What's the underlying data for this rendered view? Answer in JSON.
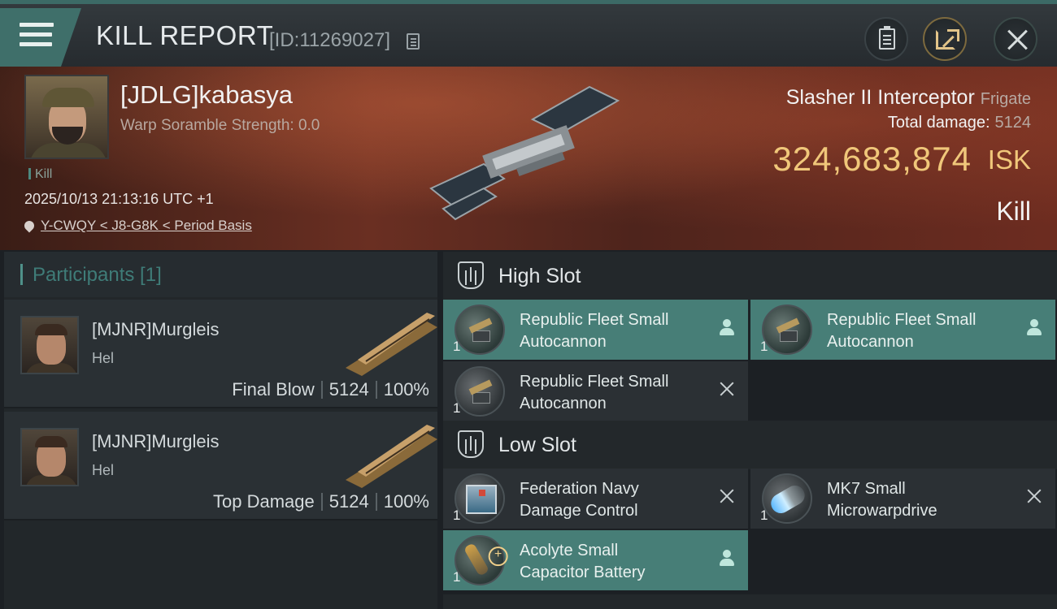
{
  "header": {
    "title": "KILL REPORT",
    "report_id": "[ID:11269027]",
    "menu_icon": "hamburger-icon",
    "buttons": [
      "clipboard-icon",
      "share-icon",
      "close-icon"
    ]
  },
  "victim": {
    "name": "[JDLG]kabasya",
    "warp_scramble": "Warp Soramble Strength: 0.0",
    "kill_tag": "Kill",
    "time": "2025/10/13 21:13:16 UTC +1",
    "location": "Y-CWQY < J8-G8K < Period Basis",
    "ship_name": "Slasher II Interceptor",
    "ship_class": "Frigate",
    "total_damage_label": "Total damage:",
    "total_damage_value": "5124",
    "isk_value": "324,683,874",
    "isk_unit": "ISK",
    "result": "Kill"
  },
  "participants": {
    "title": "Participants [1]",
    "items": [
      {
        "name": "[MJNR]Murgleis",
        "ship": "Hel",
        "role": "Final Blow",
        "damage": "5124",
        "percent": "100%"
      },
      {
        "name": "[MJNR]Murgleis",
        "ship": "Hel",
        "role": "Top Damage",
        "damage": "5124",
        "percent": "100%"
      }
    ]
  },
  "fitting": {
    "high_slot": {
      "title": "High Slot",
      "modules": [
        {
          "qty": "1",
          "line1": "Republic Fleet Small",
          "line2": "Autocannon",
          "status": "pilot-icon"
        },
        {
          "qty": "1",
          "line1": "Republic Fleet Small",
          "line2": "Autocannon",
          "status": "pilot-icon"
        },
        {
          "qty": "1",
          "line1": "Republic Fleet Small",
          "line2": "Autocannon",
          "status": "destroyed-x-icon"
        }
      ]
    },
    "low_slot": {
      "title": "Low Slot",
      "modules": [
        {
          "qty": "1",
          "line1": "Federation Navy",
          "line2": "Damage Control",
          "status": "destroyed-x-icon"
        },
        {
          "qty": "1",
          "line1": "MK7 Small",
          "line2": "Microwarpdrive",
          "status": "destroyed-x-icon"
        },
        {
          "qty": "1",
          "line1": "Acolyte Small",
          "line2": "Capacitor Battery",
          "status": "pilot-icon"
        }
      ]
    }
  },
  "colors": {
    "accent_teal": "#477e77",
    "isk_gold": "#f0c77a",
    "banner_red": "#6a2f22"
  }
}
